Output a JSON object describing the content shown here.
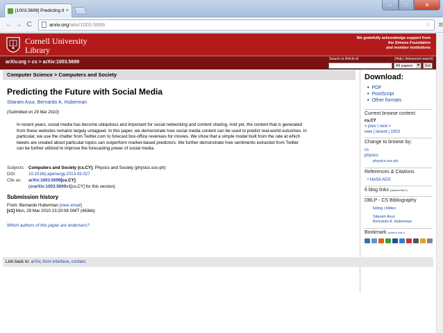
{
  "browser": {
    "tab_title": "[1003.5699] Predicting th",
    "tab_close": "×",
    "url_host": "arxiv.org",
    "url_path": "/abs/1003.5699",
    "back": "←",
    "forward": "→",
    "reload": "C",
    "star": "☆",
    "menu": "≡",
    "win_min": "–",
    "win_max": "□",
    "win_close": "✕"
  },
  "header": {
    "institution_line1": "Cornell University",
    "institution_line2": "Library",
    "ack_line1": "We gratefully acknowledge support from",
    "ack_line2": "the Simons Foundation",
    "ack_line3": "and member institutions"
  },
  "arxiv_bar": {
    "breadcrumb": "arXiv.org > cs > arXiv:1003.5699",
    "search_label": "Search or Article-id",
    "help_links": "(Help | Advanced search)",
    "search_value": "",
    "select_value": "All papers",
    "go_label": "Go!"
  },
  "subject_bar": "Computer Science > Computers and Society",
  "paper": {
    "title": "Predicting the Future with Social Media",
    "authors": "Sitaram Asur, Bernardo A. Huberman",
    "submitted": "(Submitted on 29 Mar 2010)",
    "abstract_lines": [
      "In recent years, social media has become ubiquitous and important for social networking and content sharing. And yet, the content that is generated",
      "from these websites remains largely untapped. In this paper, we demonstrate how social media content can be used to predict real-world outcomes. In",
      "particular, we use the chatter from Twitter.com to forecast box-office revenues for movies. We show that a simple model built from the rate at which",
      "tweets are created about particular topics can outperform market-based predictors. We further demonstrate how sentiments extracted from Twitter",
      "can be further utilized to improve the forecasting power of social media."
    ]
  },
  "meta": {
    "subjects_label": "Subjects:",
    "subjects_primary": "Computers and Society (cs.CY)",
    "subjects_secondary": "; Physics and Society (physics.soc-ph)",
    "doi_label": "DOI:",
    "doi_value": "10.1016/j.apenergy.2013.03.027",
    "cite_label": "Cite as:",
    "cite_id": "arXiv:1003.5699",
    "cite_cat": " [cs.CY]",
    "cite_prefix": "(or ",
    "cite_version": "arXiv:1003.5699v1",
    "cite_suffix": " [cs.CY] for this version)"
  },
  "history": {
    "title": "Submission history",
    "from_text": "From: Bernardo Huberman ",
    "view_email": "[view email]",
    "v1_label": "[v1]",
    "v1_text": " Mon, 29 Mar 2010 23:20:08 GMT (463kb)",
    "endorsers": "Which authors of this paper are endorsers?"
  },
  "rightcol": {
    "download_title": "Download:",
    "formats": [
      "PDF",
      "PostScript",
      "Other formats"
    ],
    "browse_context_label": "Current browse context:",
    "browse_context_value": "cs.CY",
    "prev_next": "< prev | next >",
    "new_recent": "new | recent | 1003",
    "change_browse": "Change to browse by:",
    "browse_cs": "cs",
    "browse_physics": "physics",
    "browse_physics_soc": "physics.soc-ph",
    "refs_title": "References & Citations",
    "nasa_ads": "NASA ADS",
    "blog_links": "6 blog links",
    "whats_this": "(what is this?)",
    "dblp_title": "DBLP - CS Bibliography",
    "dblp_listing": "listing | bibtex",
    "dblp_author1": "Sitaram Asur",
    "dblp_author2": "Bernardo A. Huberman",
    "bookmark_title": "Bookmark",
    "bookmark_whats_this": "(what is this?)",
    "bookmark_colors": [
      "#3a6fb0",
      "#6a8fd0",
      "#e06020",
      "#3aa03a",
      "#1f4f99",
      "#2f7fd0",
      "#cc3333",
      "#555555",
      "#e0a020",
      "#888888"
    ]
  },
  "footer": {
    "prefix": "Link back to: ",
    "arxiv": "arXiv",
    "sep1": ", ",
    "form": "form interface",
    "sep2": ", ",
    "contact": "contact",
    "end": "."
  }
}
